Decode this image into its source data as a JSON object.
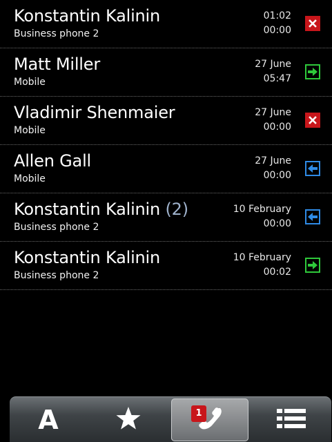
{
  "calls": [
    {
      "name": "Konstantin Kalinin",
      "count": "",
      "number_type": "Business phone 2",
      "line1": "01:02",
      "line2": "00:00",
      "call_type": "missed",
      "icon": "missed-call-icon"
    },
    {
      "name": "Matt Miller",
      "count": "",
      "number_type": "Mobile",
      "line1": "27 June",
      "line2": "05:47",
      "call_type": "outgoing",
      "icon": "outgoing-call-icon"
    },
    {
      "name": "Vladimir Shenmaier",
      "count": "",
      "number_type": "Mobile",
      "line1": "27 June",
      "line2": "00:00",
      "call_type": "missed",
      "icon": "missed-call-icon"
    },
    {
      "name": "Allen Gall",
      "count": "",
      "number_type": "Mobile",
      "line1": "27 June",
      "line2": "00:00",
      "call_type": "incoming",
      "icon": "incoming-call-icon"
    },
    {
      "name": "Konstantin Kalinin",
      "count": "(2)",
      "number_type": "Business phone 2",
      "line1": "10 February",
      "line2": "00:00",
      "call_type": "incoming",
      "icon": "incoming-call-icon"
    },
    {
      "name": "Konstantin Kalinin",
      "count": "",
      "number_type": "Business phone 2",
      "line1": "10 February",
      "line2": "00:02",
      "call_type": "outgoing",
      "icon": "outgoing-call-icon"
    }
  ],
  "tabbar": {
    "contacts_label": "A",
    "favorites_icon": "star-icon",
    "calls_icon": "phone-handset-icon",
    "calls_badge": "1",
    "menu_icon": "list-icon"
  },
  "colors": {
    "missed": "#c8161b",
    "outgoing": "#2fc93b",
    "incoming": "#2f8be6",
    "count_text": "#9fb2cc"
  }
}
